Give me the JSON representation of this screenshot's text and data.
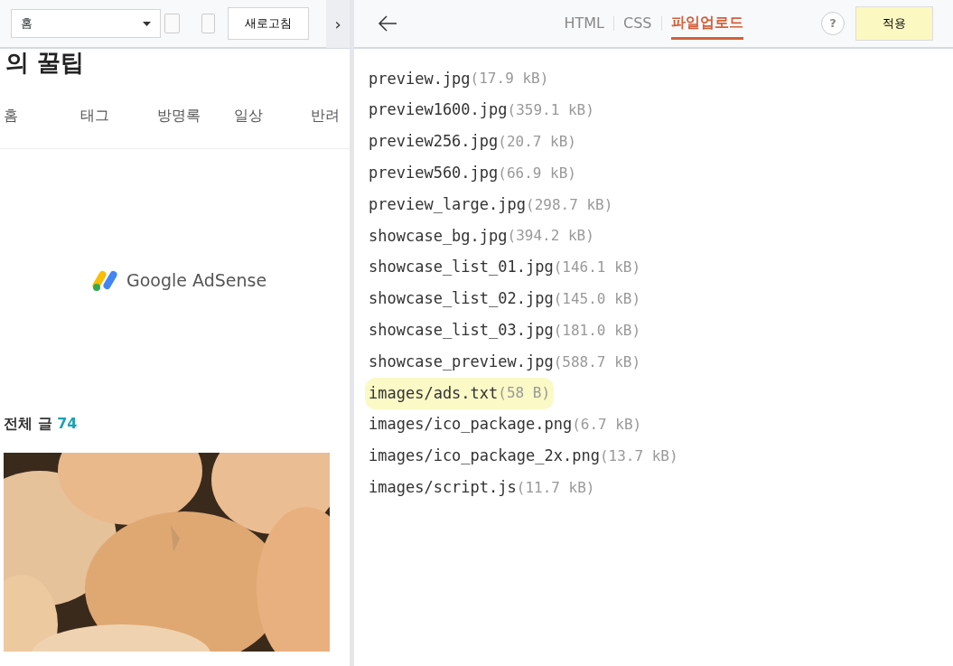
{
  "preview_toolbar": {
    "page_select": "홈",
    "refresh_button": "새로고침",
    "collapse": "›"
  },
  "blog": {
    "title": "의 꿀팁",
    "menu": [
      "홈",
      "태그",
      "방명록",
      "일상",
      "반려"
    ],
    "ad_label": "Google AdSense",
    "post_count_label": "전체 글",
    "post_count": "74"
  },
  "editor": {
    "tabs": [
      {
        "label": "HTML",
        "selected": false
      },
      {
        "label": "CSS",
        "selected": false
      },
      {
        "label": "파일업로드",
        "selected": true
      }
    ],
    "help": "?",
    "apply_button": "적용",
    "files": [
      {
        "name": "preview.jpg",
        "size": "(17.9 kB)",
        "highlighted": false
      },
      {
        "name": "preview1600.jpg",
        "size": "(359.1 kB)",
        "highlighted": false
      },
      {
        "name": "preview256.jpg",
        "size": "(20.7 kB)",
        "highlighted": false
      },
      {
        "name": "preview560.jpg",
        "size": "(66.9 kB)",
        "highlighted": false
      },
      {
        "name": "preview_large.jpg",
        "size": "(298.7 kB)",
        "highlighted": false
      },
      {
        "name": "showcase_bg.jpg",
        "size": "(394.2 kB)",
        "highlighted": false
      },
      {
        "name": "showcase_list_01.jpg",
        "size": "(146.1 kB)",
        "highlighted": false
      },
      {
        "name": "showcase_list_02.jpg",
        "size": "(145.0 kB)",
        "highlighted": false
      },
      {
        "name": "showcase_list_03.jpg",
        "size": "(181.0 kB)",
        "highlighted": false
      },
      {
        "name": "showcase_preview.jpg",
        "size": "(588.7 kB)",
        "highlighted": false
      },
      {
        "name": "images/ads.txt",
        "size": "(58 B)",
        "highlighted": true
      },
      {
        "name": "images/ico_package.png",
        "size": "(6.7 kB)",
        "highlighted": false
      },
      {
        "name": "images/ico_package_2x.png",
        "size": "(13.7 kB)",
        "highlighted": false
      },
      {
        "name": "images/script.js",
        "size": "(11.7 kB)",
        "highlighted": false
      }
    ]
  }
}
